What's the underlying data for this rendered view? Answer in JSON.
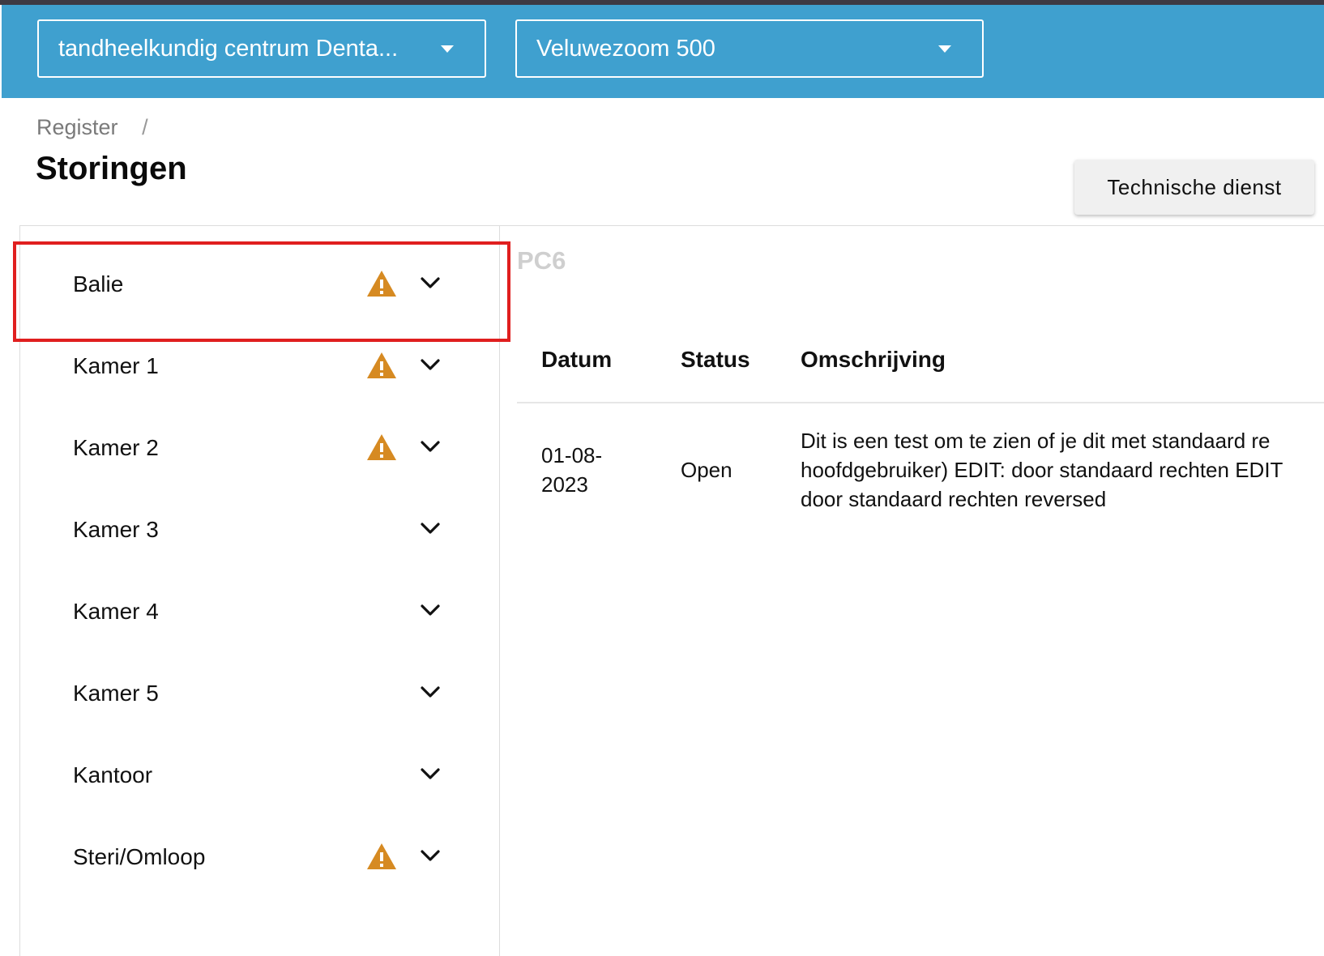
{
  "header": {
    "practice_select": "tandheelkundig centrum Denta...",
    "location_select": "Veluwezoom 500"
  },
  "breadcrumb": {
    "parent": "Register",
    "separator": "/"
  },
  "page_title": "Storingen",
  "technical_service_button": "Technische dienst",
  "rooms": [
    {
      "name": "Balie",
      "warning": true
    },
    {
      "name": "Kamer 1",
      "warning": true
    },
    {
      "name": "Kamer 2",
      "warning": true
    },
    {
      "name": "Kamer 3",
      "warning": false
    },
    {
      "name": "Kamer 4",
      "warning": false
    },
    {
      "name": "Kamer 5",
      "warning": false
    },
    {
      "name": "Kantoor",
      "warning": false
    },
    {
      "name": "Steri/Omloop",
      "warning": true
    }
  ],
  "detail": {
    "device_label": "PC6",
    "columns": {
      "date": "Datum",
      "status": "Status",
      "description": "Omschrijving"
    },
    "rows": [
      {
        "date_line1": "01-08-",
        "date_line2": "2023",
        "status": "Open",
        "description_line1": "Dit is een test om te zien of je dit met standaard re",
        "description_line2": "hoofdgebruiker) EDIT: door standaard rechten EDIT",
        "description_line3": "door standaard rechten reversed"
      }
    ]
  },
  "colors": {
    "header_bg": "#3fa0cf",
    "warning": "#d68a22",
    "highlight": "#e01f1f"
  }
}
